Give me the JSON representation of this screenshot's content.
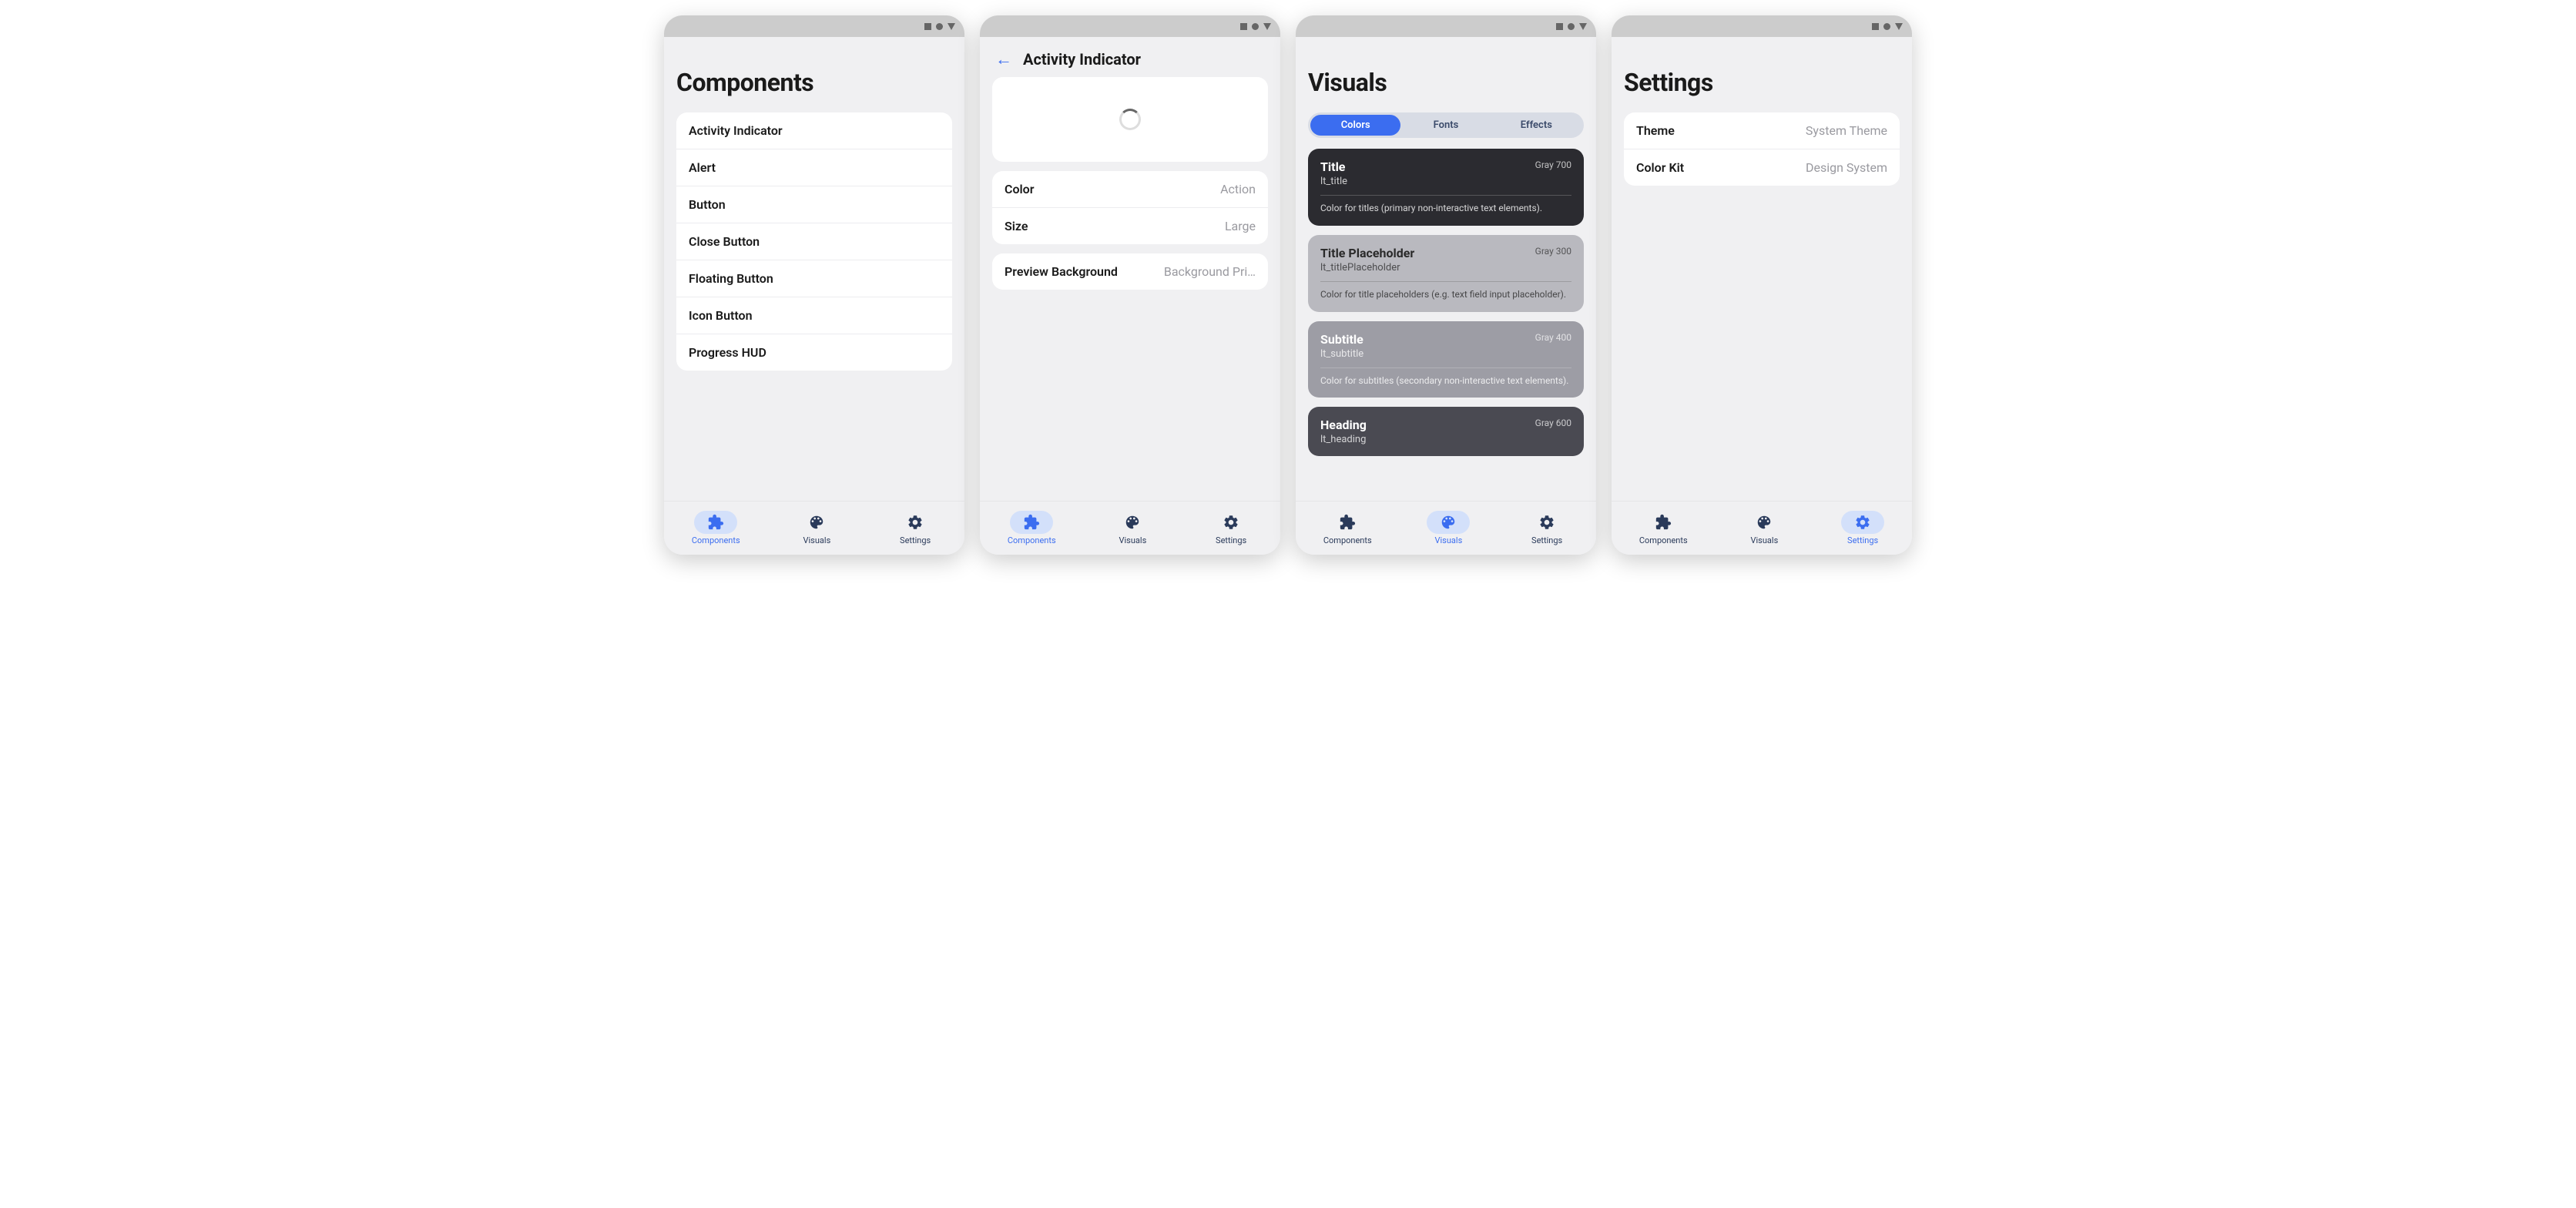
{
  "screens": {
    "components": {
      "title": "Components",
      "items": [
        "Activity Indicator",
        "Alert",
        "Button",
        "Close Button",
        "Floating Button",
        "Icon Button",
        "Progress HUD"
      ]
    },
    "detail": {
      "title": "Activity Indicator",
      "props": [
        {
          "label": "Color",
          "value": "Action"
        },
        {
          "label": "Size",
          "value": "Large"
        }
      ],
      "preview_bg": {
        "label": "Preview Background",
        "value": "Background Pri…"
      }
    },
    "visuals": {
      "title": "Visuals",
      "tabs": [
        "Colors",
        "Fonts",
        "Effects"
      ],
      "cards": [
        {
          "name": "Title",
          "token": "lt_title",
          "tag": "Gray 700",
          "desc": "Color for titles (primary non-interactive text elements).",
          "bg": "#2b2b30",
          "fg": "#ffffff"
        },
        {
          "name": "Title Placeholder",
          "token": "lt_titlePlaceholder",
          "tag": "Gray 300",
          "desc": "Color for title placeholders (e.g. text field input placeholder).",
          "bg": "#b9b9bf",
          "fg": "#2a2a2a"
        },
        {
          "name": "Subtitle",
          "token": "lt_subtitle",
          "tag": "Gray 400",
          "desc": "Color for subtitles (secondary non-interactive text elements).",
          "bg": "#9d9da5",
          "fg": "#ffffff"
        },
        {
          "name": "Heading",
          "token": "lt_heading",
          "tag": "Gray 600",
          "desc": "",
          "bg": "#4a4a52",
          "fg": "#ffffff"
        }
      ]
    },
    "settings": {
      "title": "Settings",
      "items": [
        {
          "label": "Theme",
          "value": "System Theme"
        },
        {
          "label": "Color Kit",
          "value": "Design System"
        }
      ]
    }
  },
  "bottombar": {
    "components": "Components",
    "visuals": "Visuals",
    "settings": "Settings"
  }
}
